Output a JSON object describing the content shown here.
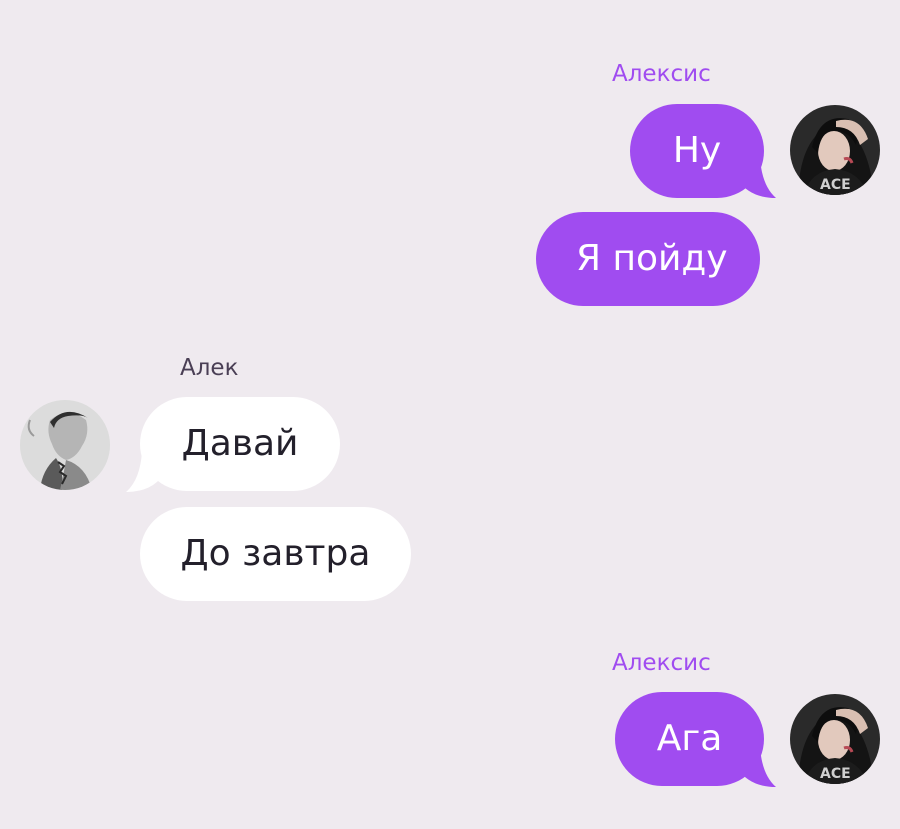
{
  "colors": {
    "background": "#efeaef",
    "sent_bubble": "#a04cf0",
    "sent_name": "#a04cf0",
    "received_bubble": "#ffffff",
    "received_name": "#4a3f55",
    "received_text": "#23202b"
  },
  "messages": [
    {
      "sender": "Алексис",
      "direction": "sent",
      "avatar_icon": "user-avatar-alexis",
      "bubbles": [
        "Ну",
        "Я пойду"
      ]
    },
    {
      "sender": "Алек",
      "direction": "received",
      "avatar_icon": "user-avatar-alek",
      "bubbles": [
        "Давай",
        "До завтра"
      ]
    },
    {
      "sender": "Алексис",
      "direction": "sent",
      "avatar_icon": "user-avatar-alexis",
      "bubbles": [
        "Ага"
      ]
    }
  ]
}
